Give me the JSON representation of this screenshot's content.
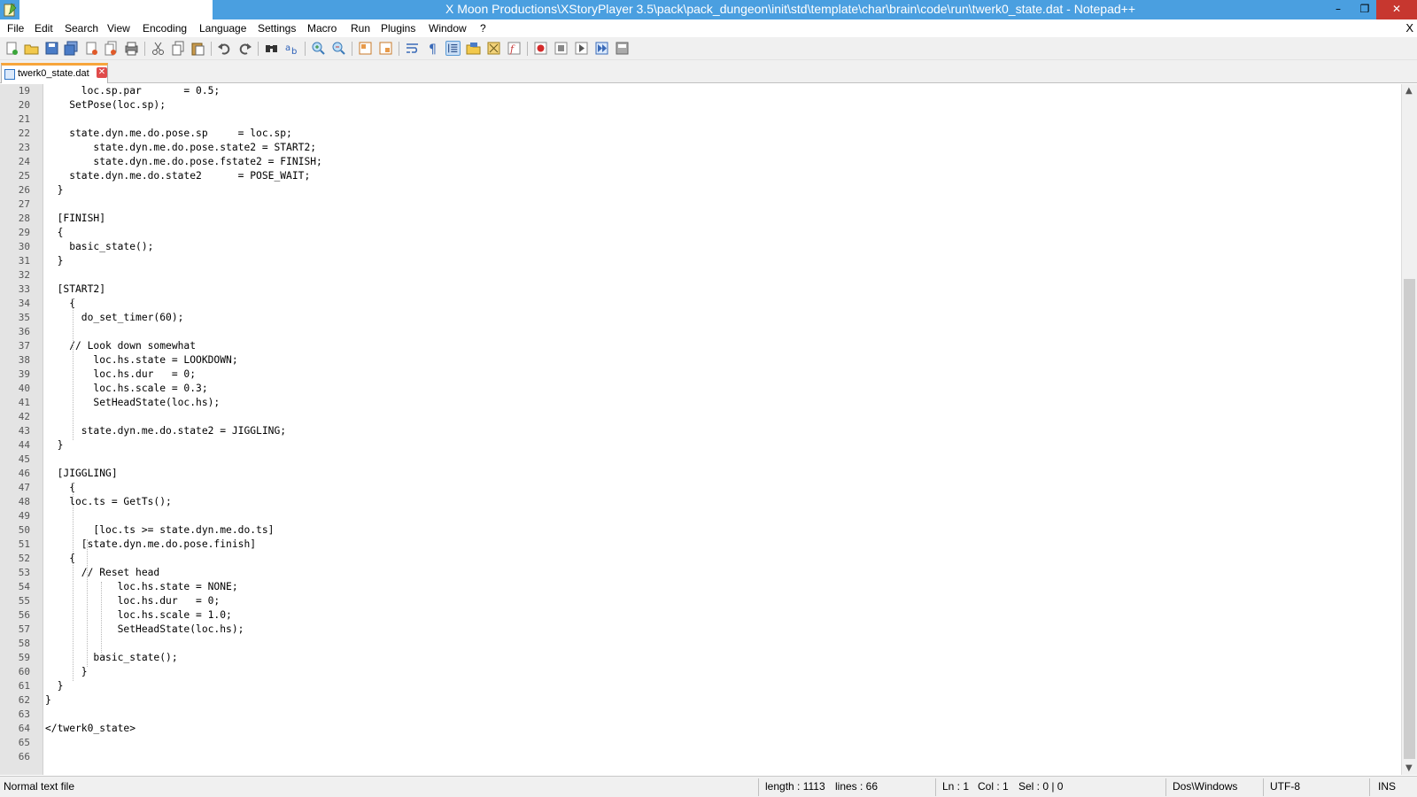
{
  "window": {
    "title": "X Moon Productions\\XStoryPlayer 3.5\\pack\\pack_dungeon\\init\\std\\template\\char\\brain\\code\\run\\twerk0_state.dat - Notepad++",
    "minimize": "–",
    "maximize": "❐",
    "close": "✕"
  },
  "menu": {
    "items": [
      "File",
      "Edit",
      "Search",
      "View",
      "Encoding",
      "Language",
      "Settings",
      "Macro",
      "Run",
      "Plugins",
      "Window",
      "?"
    ],
    "doc_close": "X"
  },
  "tab": {
    "label": "twerk0_state.dat",
    "close": "✕"
  },
  "editor": {
    "lines": [
      {
        "n": "19",
        "text": "      loc.sp.par       = 0.5;"
      },
      {
        "n": "20",
        "text": "    SetPose(loc.sp);"
      },
      {
        "n": "21",
        "text": ""
      },
      {
        "n": "22",
        "text": "    state.dyn.me.do.pose.sp     = loc.sp;"
      },
      {
        "n": "23",
        "text": "        state.dyn.me.do.pose.state2 = START2;"
      },
      {
        "n": "24",
        "text": "        state.dyn.me.do.pose.fstate2 = FINISH;"
      },
      {
        "n": "25",
        "text": "    state.dyn.me.do.state2      = POSE_WAIT;"
      },
      {
        "n": "26",
        "text": "  }"
      },
      {
        "n": "27",
        "text": ""
      },
      {
        "n": "28",
        "text": "  [FINISH]"
      },
      {
        "n": "29",
        "text": "  {"
      },
      {
        "n": "30",
        "text": "    basic_state();"
      },
      {
        "n": "31",
        "text": "  }"
      },
      {
        "n": "32",
        "text": ""
      },
      {
        "n": "33",
        "text": "  [START2]"
      },
      {
        "n": "34",
        "text": "    {"
      },
      {
        "n": "35",
        "text": "      do_set_timer(60);"
      },
      {
        "n": "36",
        "text": ""
      },
      {
        "n": "37",
        "text": "    // Look down somewhat"
      },
      {
        "n": "38",
        "text": "        loc.hs.state = LOOKDOWN;"
      },
      {
        "n": "39",
        "text": "        loc.hs.dur   = 0;"
      },
      {
        "n": "40",
        "text": "        loc.hs.scale = 0.3;"
      },
      {
        "n": "41",
        "text": "        SetHeadState(loc.hs);"
      },
      {
        "n": "42",
        "text": ""
      },
      {
        "n": "43",
        "text": "      state.dyn.me.do.state2 = JIGGLING;"
      },
      {
        "n": "44",
        "text": "  }"
      },
      {
        "n": "45",
        "text": ""
      },
      {
        "n": "46",
        "text": "  [JIGGLING]"
      },
      {
        "n": "47",
        "text": "    {"
      },
      {
        "n": "48",
        "text": "    loc.ts = GetTs();"
      },
      {
        "n": "49",
        "text": ""
      },
      {
        "n": "50",
        "text": "        [loc.ts >= state.dyn.me.do.ts]"
      },
      {
        "n": "51",
        "text": "      [state.dyn.me.do.pose.finish]"
      },
      {
        "n": "52",
        "text": "    {"
      },
      {
        "n": "53",
        "text": "      // Reset head"
      },
      {
        "n": "54",
        "text": "            loc.hs.state = NONE;"
      },
      {
        "n": "55",
        "text": "            loc.hs.dur   = 0;"
      },
      {
        "n": "56",
        "text": "            loc.hs.scale = 1.0;"
      },
      {
        "n": "57",
        "text": "            SetHeadState(loc.hs);"
      },
      {
        "n": "58",
        "text": ""
      },
      {
        "n": "59",
        "text": "        basic_state();"
      },
      {
        "n": "60",
        "text": "      }"
      },
      {
        "n": "61",
        "text": "  }"
      },
      {
        "n": "62",
        "text": "}"
      },
      {
        "n": "63",
        "text": ""
      },
      {
        "n": "64",
        "text": "</twerk0_state>"
      },
      {
        "n": "65",
        "text": ""
      },
      {
        "n": "66",
        "text": ""
      }
    ]
  },
  "status": {
    "file_type": "Normal text file",
    "length": "length : 1113",
    "lines": "lines : 66",
    "ln": "Ln : 1",
    "col": "Col : 1",
    "sel": "Sel : 0 | 0",
    "eol": "Dos\\Windows",
    "encoding": "UTF-8",
    "mode": "INS"
  },
  "colors": {
    "titlebar": "#4a9fe0",
    "tab_accent": "#f7a53b",
    "gutter": "#e4e4e4"
  }
}
